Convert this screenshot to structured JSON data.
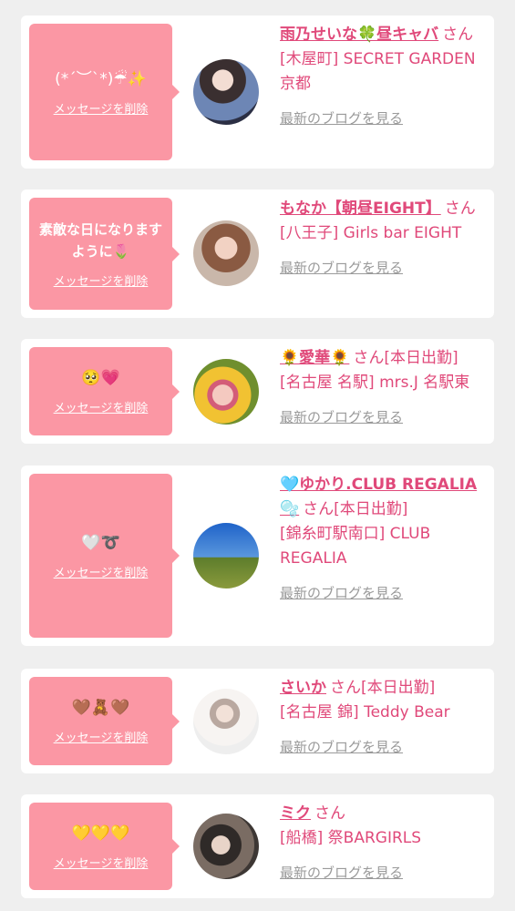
{
  "delete_label": "メッセージを削除",
  "blog_label": "最新のブログを見る",
  "colors": {
    "bubble": "#fb97a4",
    "accent": "#e0497a",
    "muted": "#9a9a9a",
    "background": "#efefef"
  },
  "cards": [
    {
      "message": "(*´︶`*)☔✨",
      "name": "雨乃せいな🍀昼キャバ",
      "suffix": "さん",
      "status": "",
      "shop": "[木屋町] SECRET GARDEN 京都"
    },
    {
      "message": "素敵な日になりますように🌷",
      "name": "もなか【朝昼EIGHT】",
      "suffix": "さん",
      "status": "",
      "shop": "[八王子] Girls bar EIGHT"
    },
    {
      "message": "🥺💗",
      "name": "🌻愛華🌻",
      "suffix": "さん",
      "status": "[本日出勤]",
      "shop": "[名古屋 名駅] mrs.J 名駅東"
    },
    {
      "message": "🤍➰",
      "name": "🩵ゆかり.CLUB REGALIA🫧",
      "suffix": "さん",
      "status": "[本日出勤]",
      "shop": "[錦糸町駅南口] CLUB REGALIA"
    },
    {
      "message": "🤎🧸🤎",
      "name": "さいか",
      "suffix": "さん",
      "status": "[本日出勤]",
      "shop": "[名古屋 錦] Teddy Bear"
    },
    {
      "message": "💛💛💛",
      "name": "ミク",
      "suffix": "さん",
      "status": "",
      "shop": "[船橋] 祭BARGIRLS"
    }
  ]
}
